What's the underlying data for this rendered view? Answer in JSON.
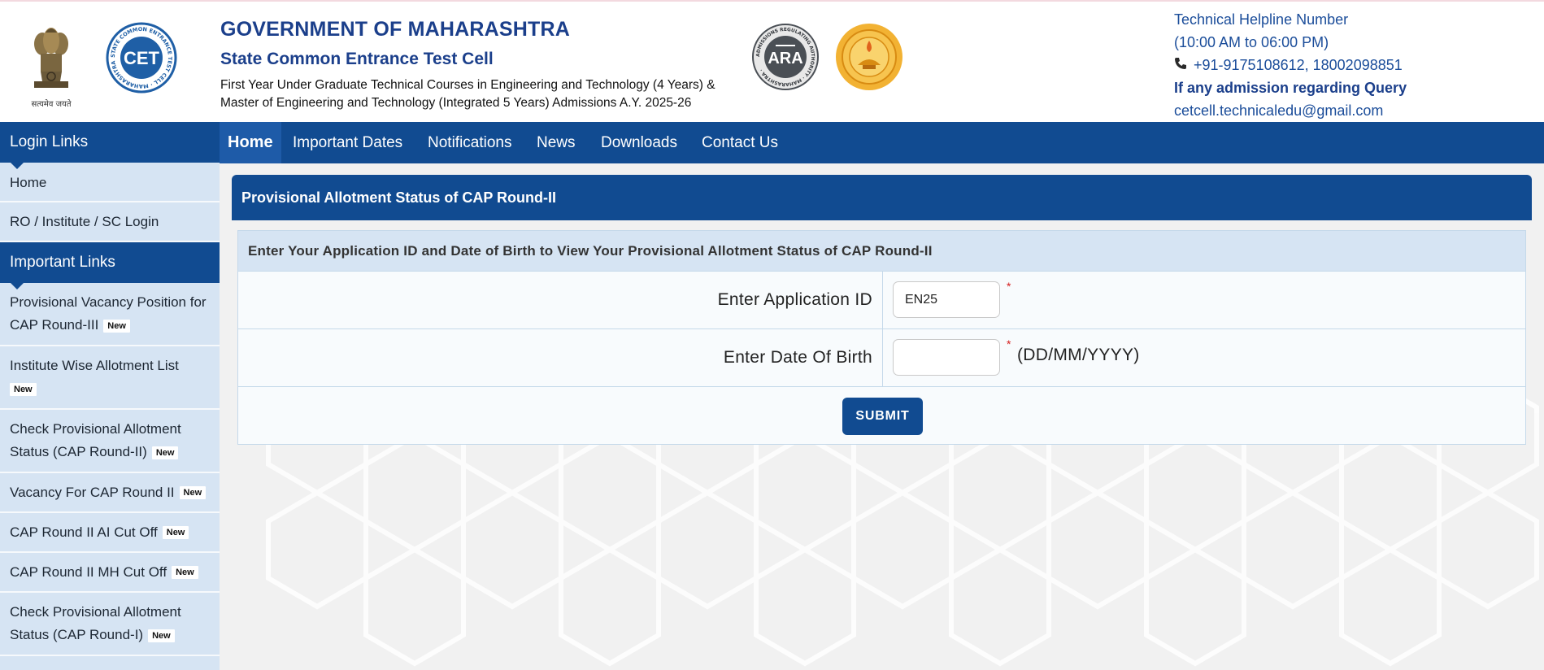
{
  "header": {
    "emblem_motto": "सत्यमेव जयते",
    "cet_logo_text": "CET",
    "cet_logo_ring_text": "STATE COMMON ENTRANCE TEST CELL · MAHARASHTRA ·",
    "ara_logo_text": "ARA",
    "ara_logo_ring_text": "ADMISSIONS REGULATING AUTHORITY · MAHARASHTRA ·",
    "gov_title": "GOVERNMENT OF MAHARASHTRA",
    "cell_title": "State Common Entrance Test Cell",
    "subtitle_line1": "First Year Under Graduate Technical Courses in Engineering and Technology (4 Years) &",
    "subtitle_line2": "Master of Engineering and Technology (Integrated 5 Years) Admissions A.Y. 2025-26",
    "helpline": {
      "title": "Technical Helpline Number",
      "hours": "(10:00 AM to 06:00 PM)",
      "phone": "+91-9175108612, 18002098851",
      "query_label": "If any admission regarding Query",
      "email": "cetcell.technicaledu@gmail.com"
    }
  },
  "sidebar": {
    "login_heading": "Login Links",
    "login_items": [
      "Home",
      "RO / Institute / SC Login"
    ],
    "important_heading": "Important Links",
    "important_items": [
      {
        "line1": "Provisional Vacancy Position for",
        "line2": "CAP Round-III",
        "badge": "New"
      },
      {
        "line1": "Institute Wise Allotment List",
        "line2": "",
        "badge": "New"
      },
      {
        "line1": "Check Provisional Allotment",
        "line2": "Status (CAP Round-II)",
        "badge": "New"
      },
      {
        "line1": "Vacancy For CAP Round II",
        "line2": "",
        "badge": "New"
      },
      {
        "line1": "CAP Round II AI Cut Off",
        "line2": "",
        "badge": "New"
      },
      {
        "line1": "CAP Round II MH Cut Off",
        "line2": "",
        "badge": "New"
      },
      {
        "line1": "Check Provisional Allotment",
        "line2": "Status (CAP Round-I)",
        "badge": "New"
      }
    ]
  },
  "nav": {
    "items": [
      "Home",
      "Important Dates",
      "Notifications",
      "News",
      "Downloads",
      "Contact Us"
    ]
  },
  "main": {
    "panel_title": "Provisional Allotment Status of CAP Round-II",
    "form_caption": "Enter Your Application ID and Date of Birth to View Your Provisional Allotment Status of CAP Round-II",
    "app_id_label": "Enter Application ID",
    "app_id_value": "EN25",
    "dob_label": "Enter Date Of Birth",
    "dob_value": "",
    "required_mark": "*",
    "dob_format": "(DD/MM/YYYY)",
    "submit_label": "SUBMIT"
  },
  "colors": {
    "primary_blue": "#114b91",
    "active_tab": "#1e5ba8",
    "sidebar_bg": "#d6e4f3",
    "title_blue": "#1b3f8b",
    "required_red": "#d41c1c"
  },
  "icons": [
    "national-emblem-icon",
    "cet-cell-logo-icon",
    "ara-logo-icon",
    "maharashtra-seal-icon",
    "phone-icon"
  ]
}
